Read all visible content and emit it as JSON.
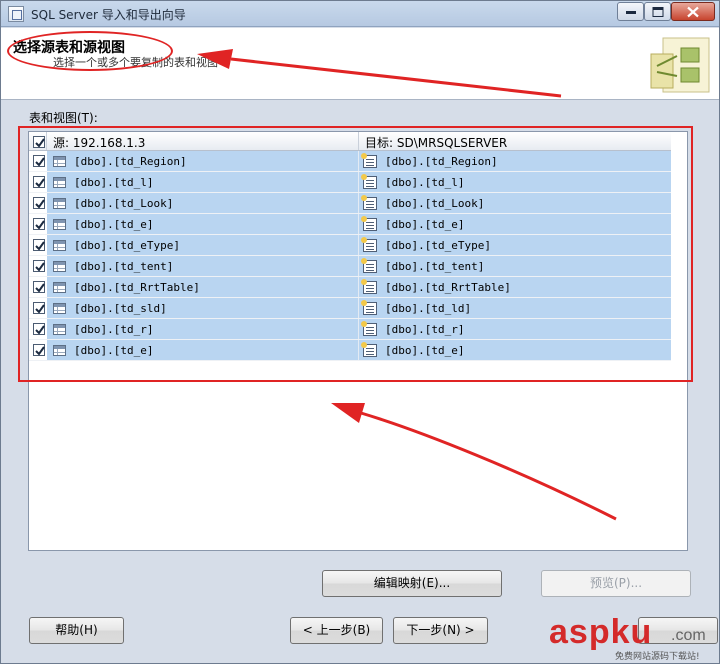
{
  "window": {
    "title": "SQL Server 导入和导出向导"
  },
  "header": {
    "title": "选择源表和源视图",
    "subtitle": "选择一个或多个要复制的表和视图"
  },
  "tables_label": "表和视图(T):",
  "grid": {
    "source_header": "源: 192.168.1.3",
    "dest_header": "目标: SD\\MRSQLSERVER",
    "rows": [
      {
        "source": "[dbo].[td_Region]",
        "dest": "[dbo].[td_Region]"
      },
      {
        "source": "[dbo].[td_l]",
        "dest": "[dbo].[td_l]"
      },
      {
        "source": "[dbo].[td_Look]",
        "dest": "[dbo].[td_Look]"
      },
      {
        "source": "[dbo].[td_e]",
        "dest": "[dbo].[td_e]"
      },
      {
        "source": "[dbo].[td_eType]",
        "dest": "[dbo].[td_eType]"
      },
      {
        "source": "[dbo].[td_tent]",
        "dest": "[dbo].[td_tent]"
      },
      {
        "source": "[dbo].[td_RrtTable]",
        "dest": "[dbo].[td_RrtTable]"
      },
      {
        "source": "[dbo].[td_sld]",
        "dest": "[dbo].[td_ld]"
      },
      {
        "source": "[dbo].[td_r]",
        "dest": "[dbo].[td_r]"
      },
      {
        "source": "[dbo].[td_e]",
        "dest": "[dbo].[td_e]"
      }
    ]
  },
  "buttons": {
    "edit_mapping": "编辑映射(E)...",
    "preview": "预览(P)...",
    "help": "帮助(H)",
    "back": "< 上一步(B)",
    "next": "下一步(N) >"
  },
  "watermark": {
    "brand": "aspku",
    "suffix": ".com",
    "tagline": "免费网站源码下载站!"
  },
  "colors": {
    "selection": "#b9d5f1",
    "annotation_red": "#e02424"
  }
}
